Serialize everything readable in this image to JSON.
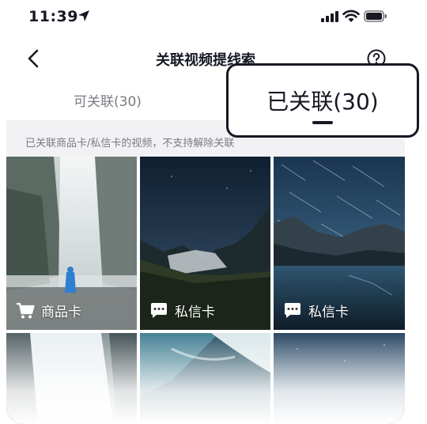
{
  "status_bar": {
    "time": "11:39"
  },
  "nav": {
    "title": "关联视频提线索"
  },
  "tabs": {
    "available_label": "可关联(30)",
    "linked_label": "已关联(30)"
  },
  "notice": "已关联商品卡/私信卡的视频，不支持解除关联",
  "videos": [
    {
      "card_label": "商品卡",
      "card_icon": "cart-icon"
    },
    {
      "card_label": "私信卡",
      "card_icon": "chat-bubble-icon"
    },
    {
      "card_label": "私信卡",
      "card_icon": "chat-bubble-icon"
    }
  ],
  "colors": {
    "text_primary": "#161823",
    "text_secondary": "#7a7b82",
    "strip_bg": "#f2f2f4"
  }
}
